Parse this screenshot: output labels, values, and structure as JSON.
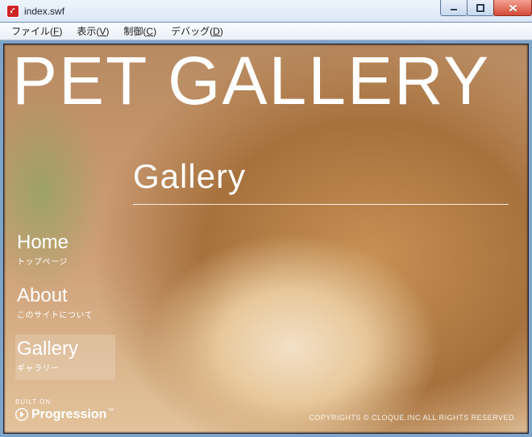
{
  "window": {
    "title": "index.swf"
  },
  "menubar": {
    "items": [
      {
        "label": "ファイル",
        "accel": "F"
      },
      {
        "label": "表示",
        "accel": "V"
      },
      {
        "label": "制御",
        "accel": "C"
      },
      {
        "label": "デバッグ",
        "accel": "D"
      }
    ]
  },
  "content": {
    "main_title": "PET GALLERY",
    "section_heading": "Gallery"
  },
  "nav": {
    "items": [
      {
        "en": "Home",
        "ja": "トップページ",
        "active": false
      },
      {
        "en": "About",
        "ja": "このサイトについて",
        "active": false
      },
      {
        "en": "Gallery",
        "ja": "ギャラリー",
        "active": true
      }
    ]
  },
  "footer": {
    "built_on": "BUILT ON",
    "framework": "Progression",
    "tm": "™",
    "copyright": "COPYRIGHTS © CLOQUE.INC ALL RIGHTS RESERVED."
  }
}
